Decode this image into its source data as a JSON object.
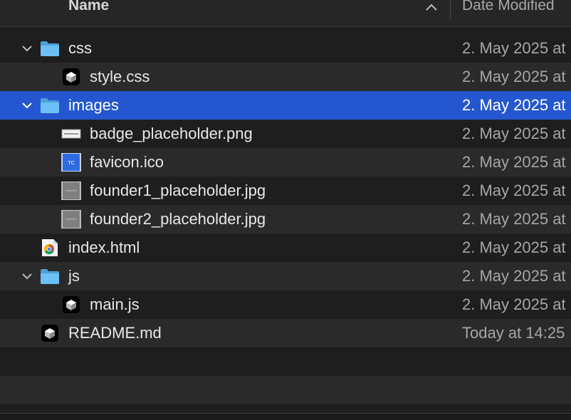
{
  "header": {
    "name_label": "Name",
    "date_label": "Date Modified"
  },
  "colors": {
    "selection": "#2457cf",
    "folder": "#5fb4f2",
    "row_alt": "#2a2a2a",
    "background": "#1e1e1e"
  },
  "files": [
    {
      "name": "css",
      "date": "2. May 2025 at",
      "kind": "folder",
      "expanded": true,
      "icon": "folder-icon"
    },
    {
      "name": "style.css",
      "date": "2. May 2025 at",
      "kind": "file",
      "icon": "code-file-icon"
    },
    {
      "name": "images",
      "date": "2. May 2025 at",
      "kind": "folder",
      "expanded": true,
      "selected": true,
      "icon": "folder-icon"
    },
    {
      "name": "badge_placeholder.png",
      "date": "2. May 2025 at",
      "kind": "file",
      "icon": "image-thumbnail-icon"
    },
    {
      "name": "favicon.ico",
      "date": "2. May 2025 at",
      "kind": "file",
      "icon": "favicon-thumbnail-icon",
      "icon_text": "TC"
    },
    {
      "name": "founder1_placeholder.jpg",
      "date": "2. May 2025 at",
      "kind": "file",
      "icon": "photo-thumbnail-icon"
    },
    {
      "name": "founder2_placeholder.jpg",
      "date": "2. May 2025 at",
      "kind": "file",
      "icon": "photo-thumbnail-icon"
    },
    {
      "name": "index.html",
      "date": "2. May 2025 at",
      "kind": "file",
      "icon": "chrome-html-icon"
    },
    {
      "name": "js",
      "date": "2. May 2025 at",
      "kind": "folder",
      "expanded": true,
      "icon": "folder-icon"
    },
    {
      "name": "main.js",
      "date": "2. May 2025 at",
      "kind": "file",
      "icon": "code-file-icon"
    },
    {
      "name": "README.md",
      "date": "Today at 14:25",
      "kind": "file",
      "icon": "code-file-icon"
    }
  ]
}
